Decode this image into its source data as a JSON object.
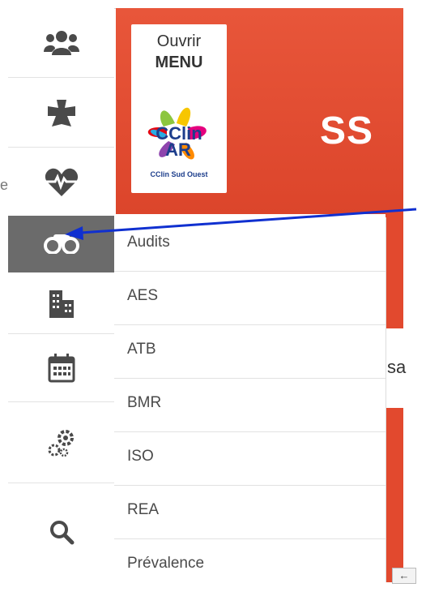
{
  "header": {
    "open_label": "Ouvrir",
    "menu_label": "MENU",
    "logo_subtitle": "CClin Sud Ouest",
    "title_fragment": "SS",
    "brand_red": "#e2492e"
  },
  "sidebar": {
    "cut_text": "e",
    "items": [
      {
        "icon": "users-icon"
      },
      {
        "icon": "puzzle-icon"
      },
      {
        "icon": "heartbeat-icon"
      },
      {
        "icon": "binoculars-icon",
        "active": true
      },
      {
        "icon": "building-icon"
      },
      {
        "icon": "calendar-icon"
      },
      {
        "icon": "gears-icon"
      },
      {
        "icon": "search-icon"
      }
    ]
  },
  "submenu": {
    "items": [
      "Audits",
      "AES",
      "ATB",
      "BMR",
      "ISO",
      "REA",
      "Prévalence"
    ]
  },
  "content": {
    "fragment_text": "sa",
    "scroll_glyph": "←"
  },
  "annotation": {
    "arrow_color": "#1030d0"
  }
}
